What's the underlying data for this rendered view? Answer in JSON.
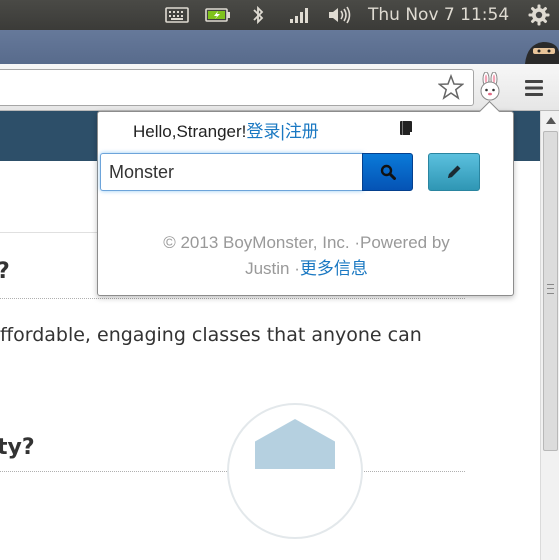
{
  "system_panel": {
    "clock": "Thu Nov  7  11:54",
    "icons": [
      "keyboard-icon",
      "battery-icon",
      "bluetooth-icon",
      "signal-icon",
      "volume-icon",
      "gear-icon"
    ]
  },
  "browser": {
    "toolbar_icons": [
      "bookmark-star-icon",
      "extension-bunny-icon",
      "menu-icon"
    ]
  },
  "page": {
    "heading_1_tail": "?",
    "body_text": "ffordable, engaging classes that anyone can",
    "heading_2_tail": "ty?"
  },
  "popup": {
    "greeting": "Hello,Stranger!",
    "login_link": "登录",
    "separator": "|",
    "register_link": "注册",
    "search_value": "Monster",
    "footer_line1": "© 2013 BoyMonster, Inc. ·Powered by",
    "footer_line2_prefix": "Justin ·",
    "more_info_link": "更多信息",
    "colors": {
      "link": "#1a78c2",
      "search_button": "#0553b5",
      "edit_button": "#2f96b4"
    }
  }
}
